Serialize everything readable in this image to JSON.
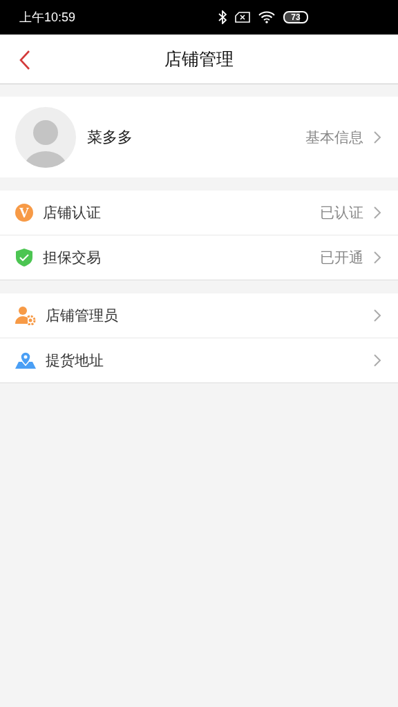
{
  "status_bar": {
    "time": "上午10:59",
    "battery": "73"
  },
  "nav": {
    "title": "店铺管理"
  },
  "profile": {
    "name": "菜多多",
    "link": "基本信息"
  },
  "groups": [
    {
      "items": [
        {
          "kind": "verified",
          "badge": "V",
          "label": "店铺认证",
          "value": "已认证"
        },
        {
          "kind": "shield",
          "label": "担保交易",
          "value": "已开通"
        }
      ]
    },
    {
      "items": [
        {
          "kind": "admin",
          "label": "店铺管理员"
        },
        {
          "kind": "location",
          "label": "提货地址"
        }
      ]
    }
  ]
}
